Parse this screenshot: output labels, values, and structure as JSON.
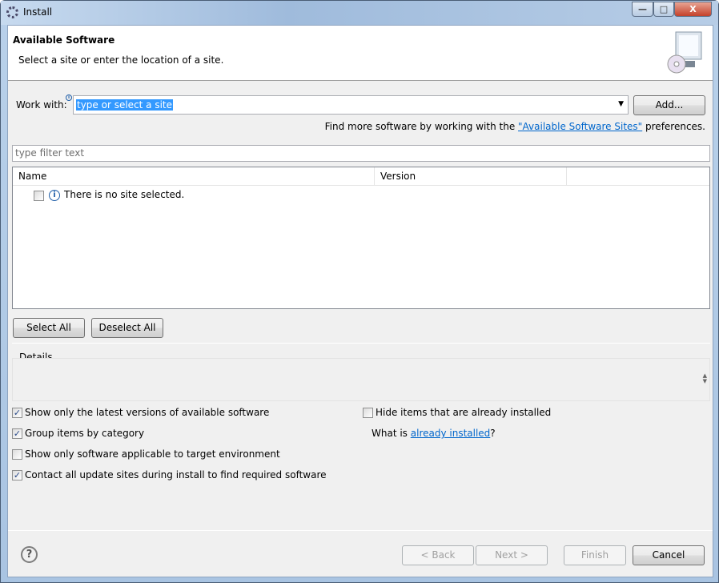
{
  "window": {
    "title": "Install",
    "controls": {
      "minimize": "—",
      "maximize": "□",
      "close": "X"
    }
  },
  "header": {
    "title": "Available Software",
    "subtitle": "Select a site or enter the location of a site.",
    "icon": "monitor-cd-icon"
  },
  "work_with": {
    "label": "Work with:",
    "value": "type or select a site",
    "add_label": "Add...",
    "hint_prefix": "Find more software by working with the ",
    "hint_link": "\"Available Software Sites\"",
    "hint_suffix": " preferences."
  },
  "filter": {
    "placeholder": "type filter text"
  },
  "table": {
    "columns": [
      "Name",
      "Version"
    ],
    "rows": [
      {
        "checked": false,
        "icon": "info-icon",
        "text": "There is no site selected."
      }
    ]
  },
  "buttons": {
    "select_all": "Select All",
    "deselect_all": "Deselect All",
    "back": "< Back",
    "next": "Next >",
    "finish": "Finish",
    "cancel": "Cancel"
  },
  "details": {
    "label": "Details"
  },
  "options": [
    {
      "label": "Show only the latest versions of available software",
      "checked": true
    },
    {
      "label": "Group items by category",
      "checked": true
    },
    {
      "label": "Show only software applicable to target environment",
      "checked": false
    },
    {
      "label": "Contact all update sites during install to find required software",
      "checked": true
    },
    {
      "label": "Hide items that are already installed",
      "checked": false
    }
  ],
  "installed": {
    "prefix": "What is ",
    "link": "already installed",
    "suffix": "?"
  },
  "colors": {
    "link": "#0066cc",
    "selection": "#3399ff"
  }
}
